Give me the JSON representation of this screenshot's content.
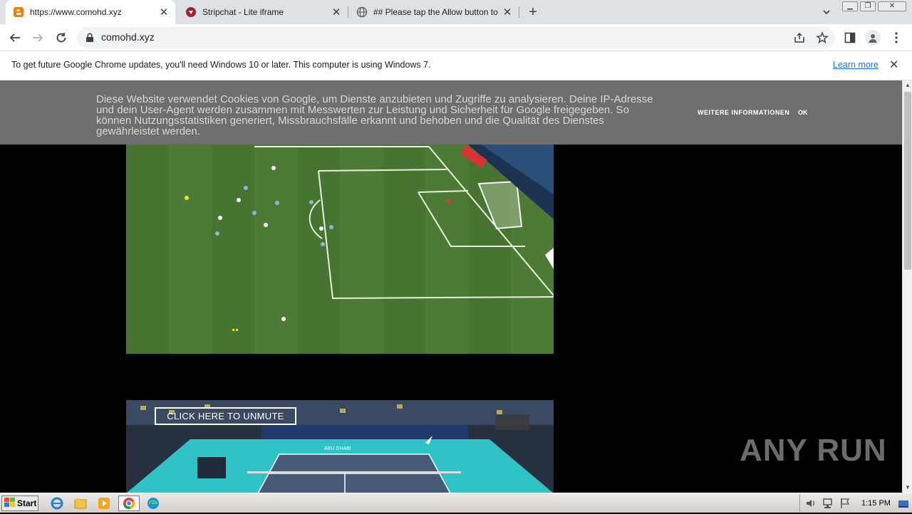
{
  "tabs": [
    {
      "title": "https://www.comohd.xyz",
      "favicon": "blogger-icon"
    },
    {
      "title": "Stripchat - Lite iframe",
      "favicon": "stripchat-icon"
    },
    {
      "title": "## Please tap the Allow button to c",
      "favicon": "globe-icon"
    }
  ],
  "address_bar": {
    "url": "comohd.xyz"
  },
  "infobar": {
    "message": "To get future Google Chrome updates, you'll need Windows 10 or later. This computer is using Windows 7.",
    "link": "Learn more"
  },
  "cookie_banner": {
    "text": "Diese Website verwendet Cookies von Google, um Dienste anzubieten und Zugriffe zu analysieren. Deine IP-Adresse und dein User-Agent werden zusammen mit Messwerten zur Leistung und Sicherheit für Google freigegeben. So können Nutzungsstatistiken generiert, Missbrauchsfälle erkannt und behoben und die Qualität des Dienstes gewährleistet werden.",
    "more_label": "WEITERE INFORMATIONEN",
    "ok_label": "OK"
  },
  "video2": {
    "unmute_label": "CLICK HERE TO UNMUTE",
    "banner_text": "ABU DHABI"
  },
  "watermark": "ANY RUN",
  "taskbar": {
    "start_label": "Start",
    "clock": "1:15 PM"
  },
  "colors": {
    "tabstrip": "#dee1e6",
    "cookie_bg": "#6e6e6e",
    "link": "#1a73e8",
    "pitch": "#4d7a34",
    "court": "#2fc3c8"
  }
}
